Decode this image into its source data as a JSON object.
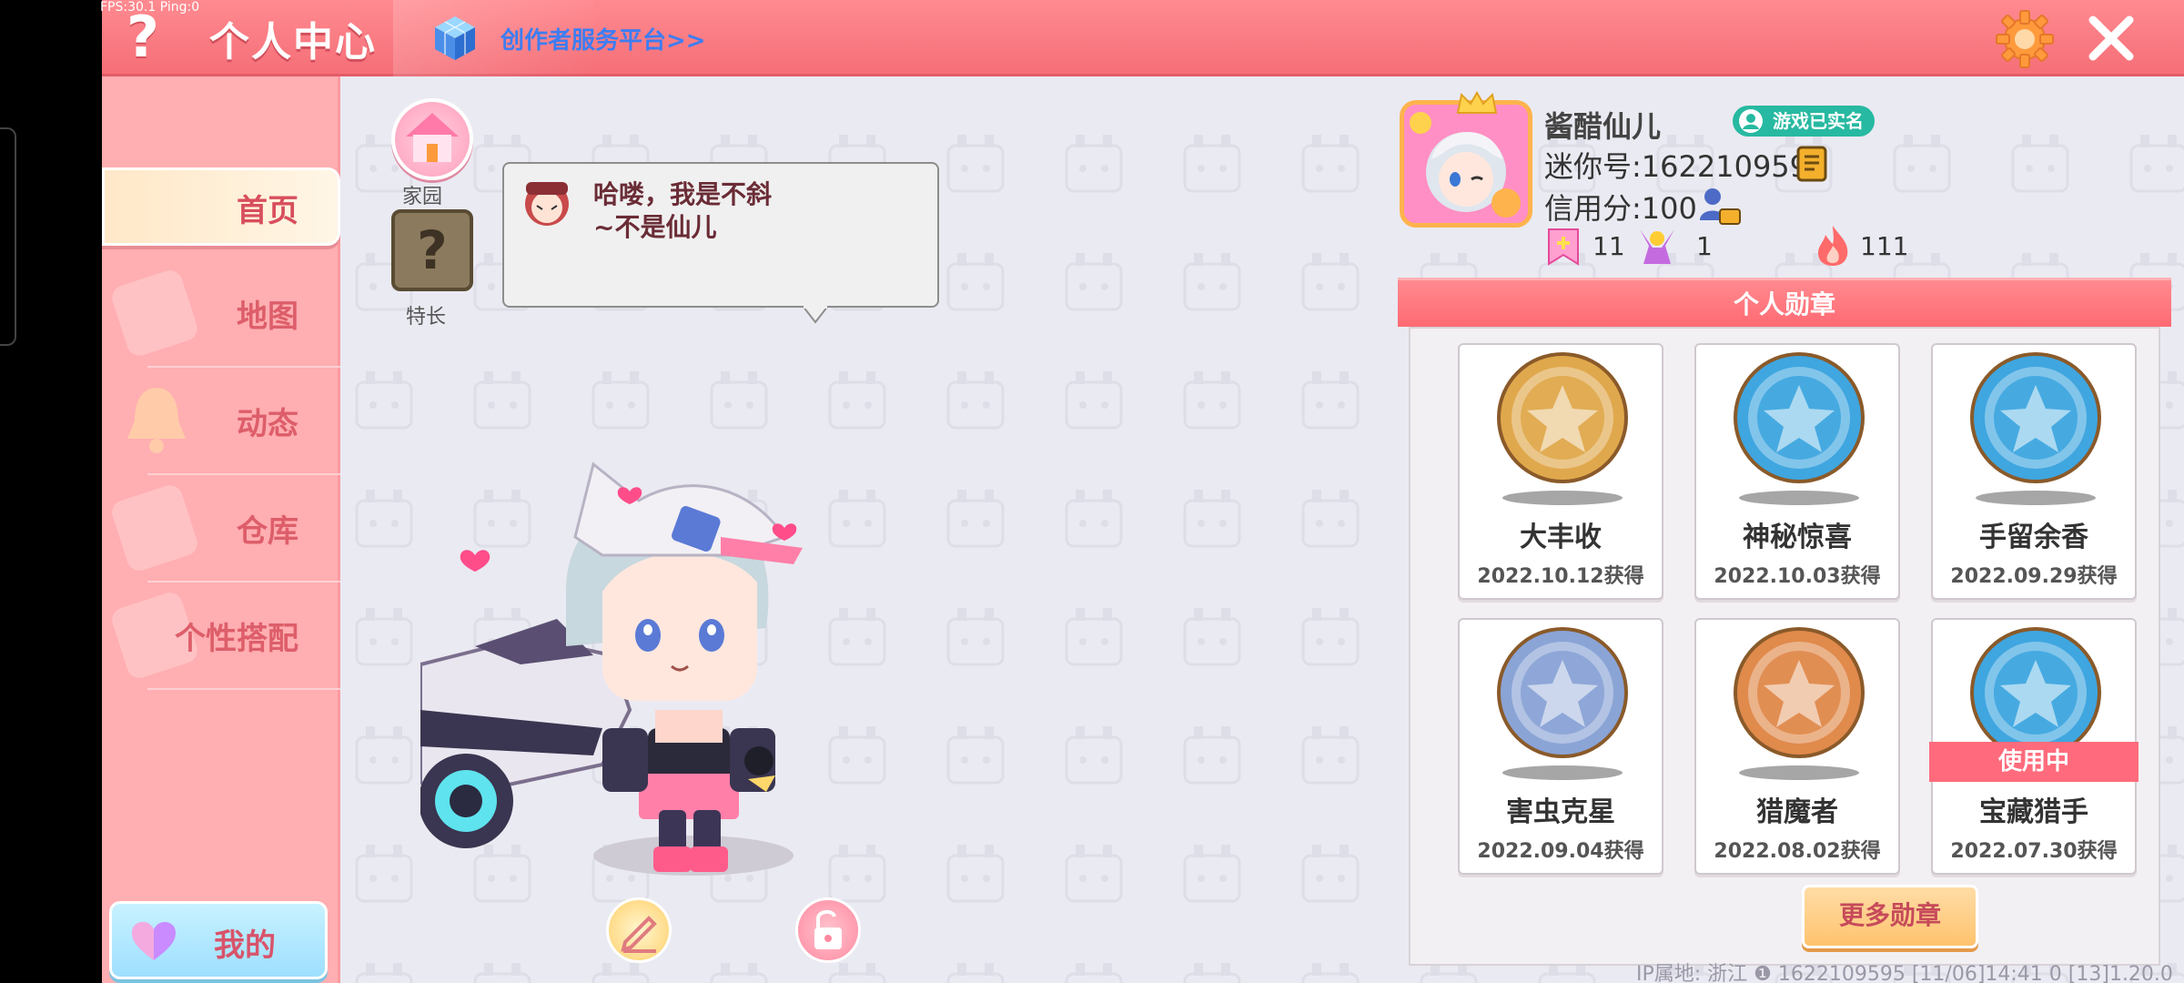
{
  "status": {
    "fps": "FPS:30.1  Ping:0"
  },
  "topbar": {
    "help_icon": "?",
    "title": "个人中心",
    "creator_link": "创作者服务平台>>",
    "icons": [
      "help-icon",
      "cube-icon",
      "gear-icon",
      "close-icon"
    ]
  },
  "sidebar": {
    "items": [
      {
        "label": "首页",
        "active": true
      },
      {
        "label": "地图"
      },
      {
        "label": "动态"
      },
      {
        "label": "仓库"
      },
      {
        "label": "个性搭配"
      }
    ],
    "mine_label": "我的"
  },
  "scene": {
    "home_label": "家园",
    "skill_icon": "?",
    "skill_label": "特长",
    "greeting_line1": "哈喽，我是不斜",
    "greeting_line2": "~不是仙儿"
  },
  "profile": {
    "username": "酱醋仙儿",
    "verified": "游戏已实名",
    "mini_id": "迷你号:1622109595",
    "credit": "信用分:100",
    "likes": "11",
    "fans": "1",
    "heat": "111"
  },
  "badges": {
    "title": "个人勋章",
    "in_use_label": "使用中",
    "items": [
      {
        "name": "大丰收",
        "date": "2022.10.12获得",
        "color": "#e0a84c"
      },
      {
        "name": "神秘惊喜",
        "date": "2022.10.03获得",
        "color": "#3fa6e0"
      },
      {
        "name": "手留余香",
        "date": "2022.09.29获得",
        "color": "#3fa6e0"
      },
      {
        "name": "害虫克星",
        "date": "2022.09.04获得",
        "color": "#8aa4d6"
      },
      {
        "name": "猎魔者",
        "date": "2022.08.02获得",
        "color": "#e08a4c"
      },
      {
        "name": "宝藏猎手",
        "date": "2022.07.30获得",
        "color": "#3fa6e0",
        "in_use": true
      }
    ],
    "more_label": "更多勋章"
  },
  "footer": "IP属地: 浙江 ❶      1622109595    [11/06]14:41 0  [13]1.20.0"
}
